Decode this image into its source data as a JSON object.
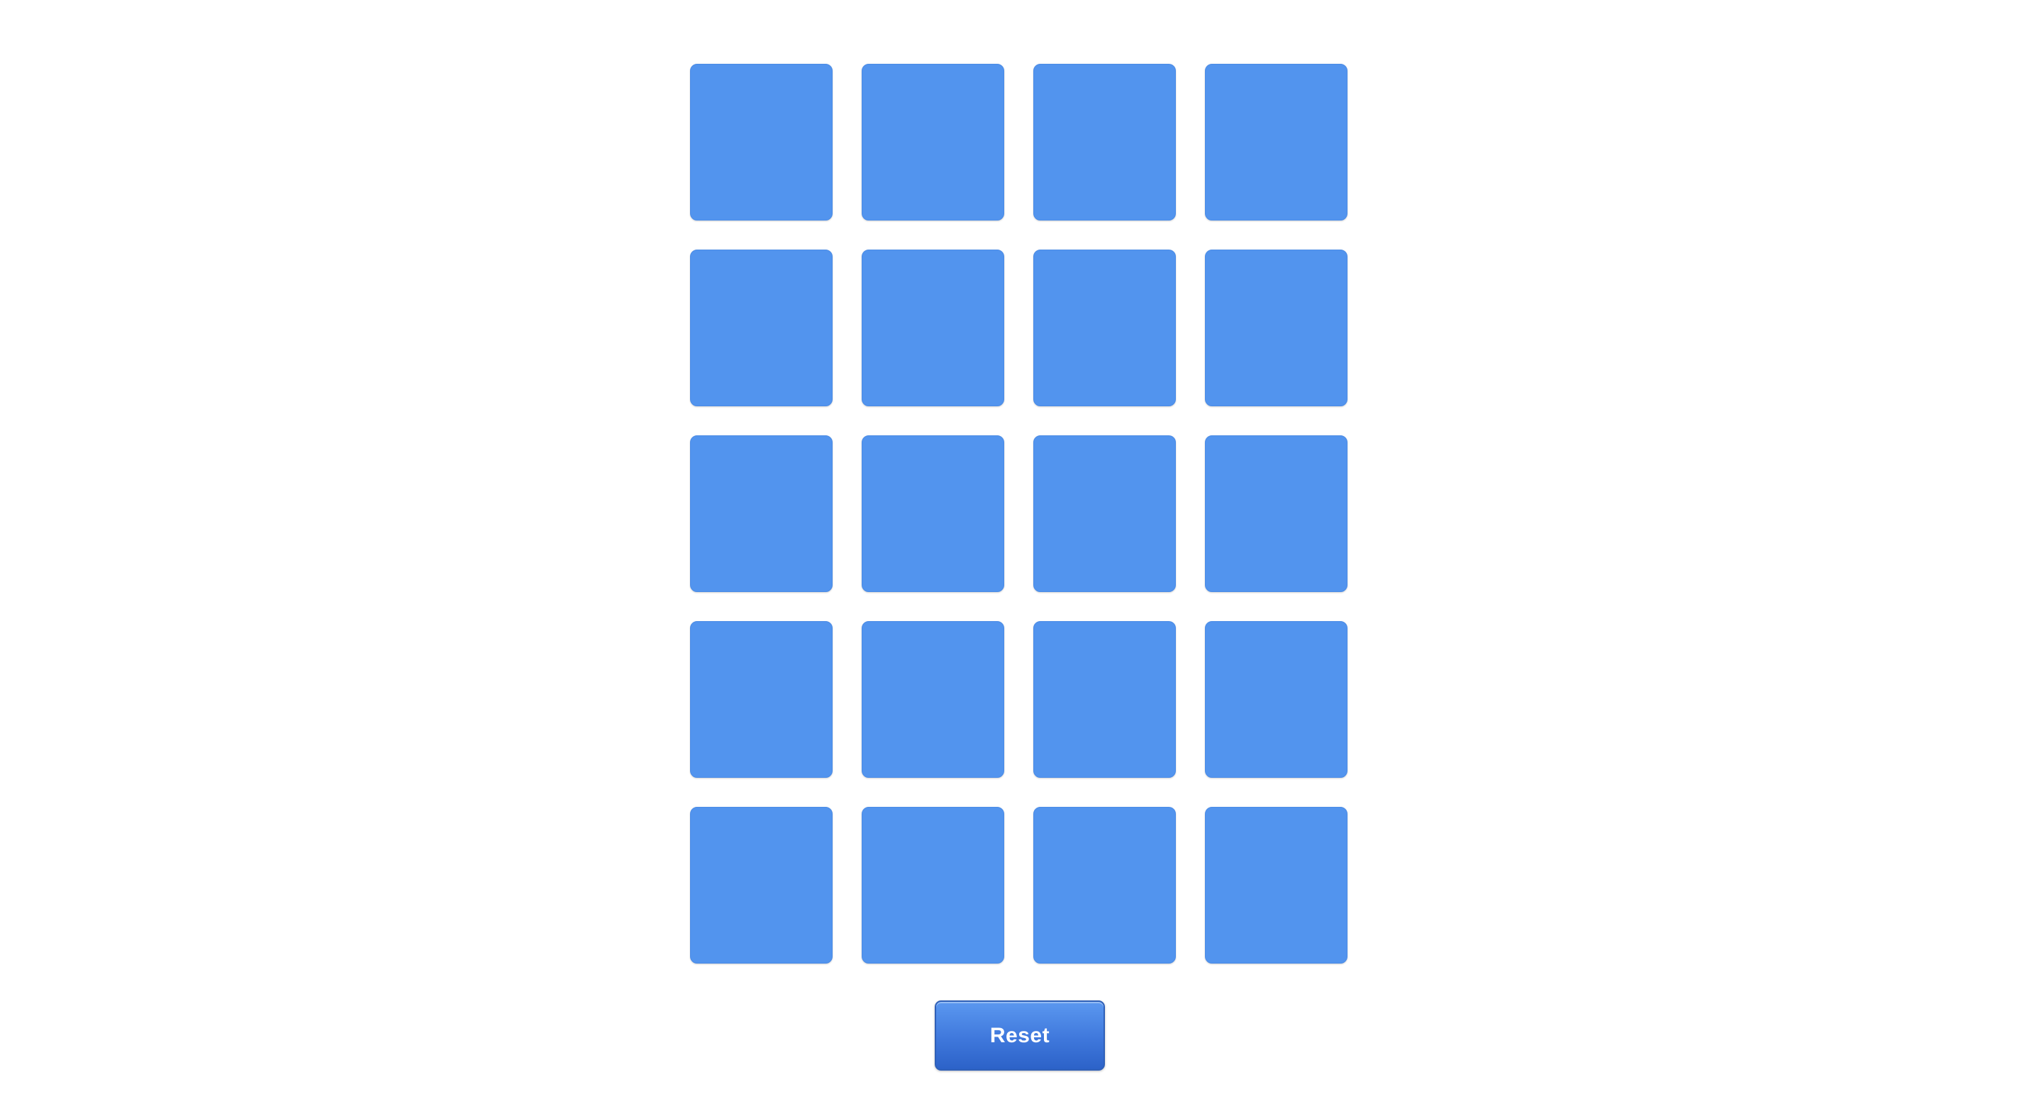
{
  "board": {
    "card_color": "#5294ee",
    "rows": 5,
    "columns": 4,
    "cards": [
      {
        "face": "hidden"
      },
      {
        "face": "hidden"
      },
      {
        "face": "hidden"
      },
      {
        "face": "hidden"
      },
      {
        "face": "hidden"
      },
      {
        "face": "hidden"
      },
      {
        "face": "hidden"
      },
      {
        "face": "hidden"
      },
      {
        "face": "hidden"
      },
      {
        "face": "hidden"
      },
      {
        "face": "hidden"
      },
      {
        "face": "hidden"
      },
      {
        "face": "hidden"
      },
      {
        "face": "hidden"
      },
      {
        "face": "hidden"
      },
      {
        "face": "hidden"
      },
      {
        "face": "hidden"
      },
      {
        "face": "hidden"
      },
      {
        "face": "hidden"
      },
      {
        "face": "hidden"
      }
    ]
  },
  "controls": {
    "reset_label": "Reset",
    "reset_color": "#3f78dc"
  }
}
